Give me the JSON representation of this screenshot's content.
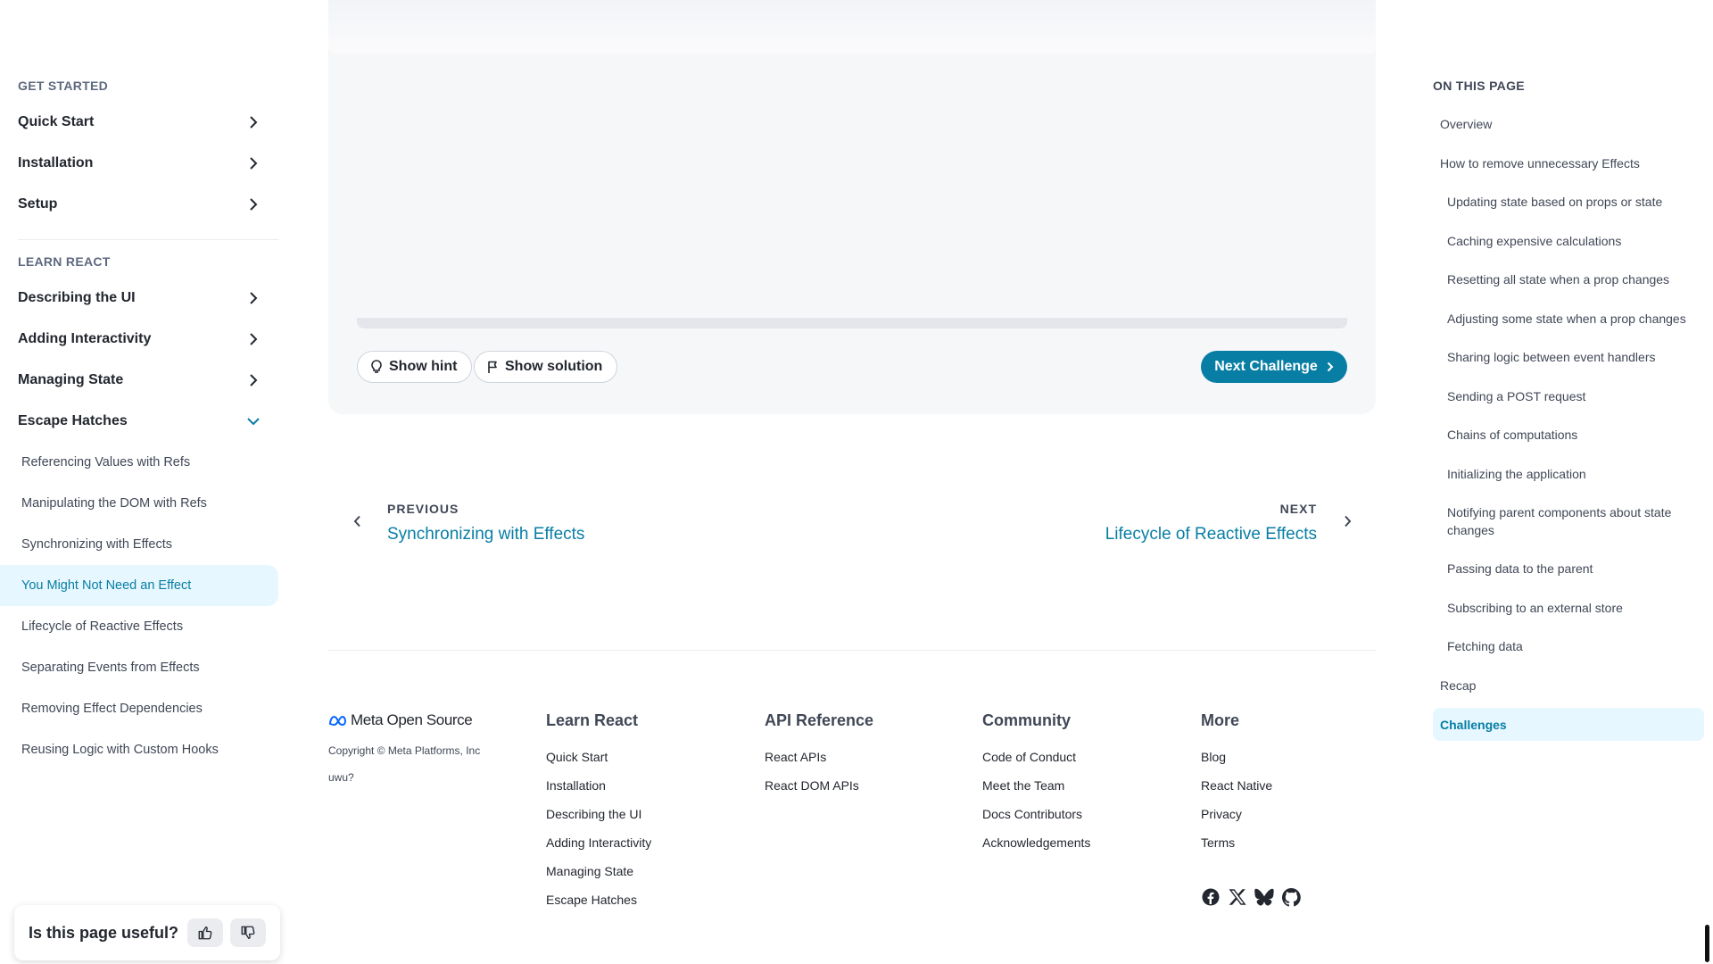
{
  "sidebar": {
    "get_started": "GET STARTED",
    "get_started_items": [
      "Quick Start",
      "Installation",
      "Setup"
    ],
    "learn_react": "LEARN REACT",
    "learn_items": [
      "Describing the UI",
      "Adding Interactivity",
      "Managing State",
      "Escape Hatches"
    ],
    "escape_sub": [
      "Referencing Values with Refs",
      "Manipulating the DOM with Refs",
      "Synchronizing with Effects",
      "You Might Not Need an Effect",
      "Lifecycle of Reactive Effects",
      "Separating Events from Effects",
      "Removing Effect Dependencies",
      "Reusing Logic with Custom Hooks"
    ],
    "active_item": "You Might Not Need an Effect"
  },
  "feedback": {
    "question": "Is this page useful?"
  },
  "challenge": {
    "show_hint": "Show hint",
    "show_solution": "Show solution",
    "next_challenge": "Next Challenge"
  },
  "pager": {
    "prev_label": "PREVIOUS",
    "prev_title": "Synchronizing with Effects",
    "next_label": "NEXT",
    "next_title": "Lifecycle of Reactive Effects"
  },
  "footer": {
    "brand": "Meta Open Source",
    "copyright": "Copyright © Meta Platforms, Inc",
    "uwu": "uwu?",
    "columns": [
      {
        "title": "Learn React",
        "links": [
          "Quick Start",
          "Installation",
          "Describing the UI",
          "Adding Interactivity",
          "Managing State",
          "Escape Hatches"
        ]
      },
      {
        "title": "API Reference",
        "links": [
          "React APIs",
          "React DOM APIs"
        ]
      },
      {
        "title": "Community",
        "links": [
          "Code of Conduct",
          "Meet the Team",
          "Docs Contributors",
          "Acknowledgements"
        ]
      },
      {
        "title": "More",
        "links": [
          "Blog",
          "React Native",
          "Privacy",
          "Terms"
        ]
      }
    ],
    "social_icons": [
      "facebook-icon",
      "x-icon",
      "bluesky-icon",
      "github-icon"
    ]
  },
  "toc": {
    "heading": "ON THIS PAGE",
    "items": [
      "Overview",
      "How to remove unnecessary Effects",
      "Updating state based on props or state",
      "Caching expensive calculations",
      "Resetting all state when a prop changes",
      "Adjusting some state when a prop changes",
      "Sharing logic between event handlers",
      "Sending a POST request",
      "Chains of computations",
      "Initializing the application",
      "Notifying parent components about state changes",
      "Passing data to the parent",
      "Subscribing to an external store",
      "Fetching data",
      "Recap",
      "Challenges"
    ],
    "active": "Challenges"
  },
  "colors": {
    "accent": "#087ea4",
    "active_bg": "#e6f7ff",
    "text": "#23272f",
    "muted": "#5e687e"
  }
}
